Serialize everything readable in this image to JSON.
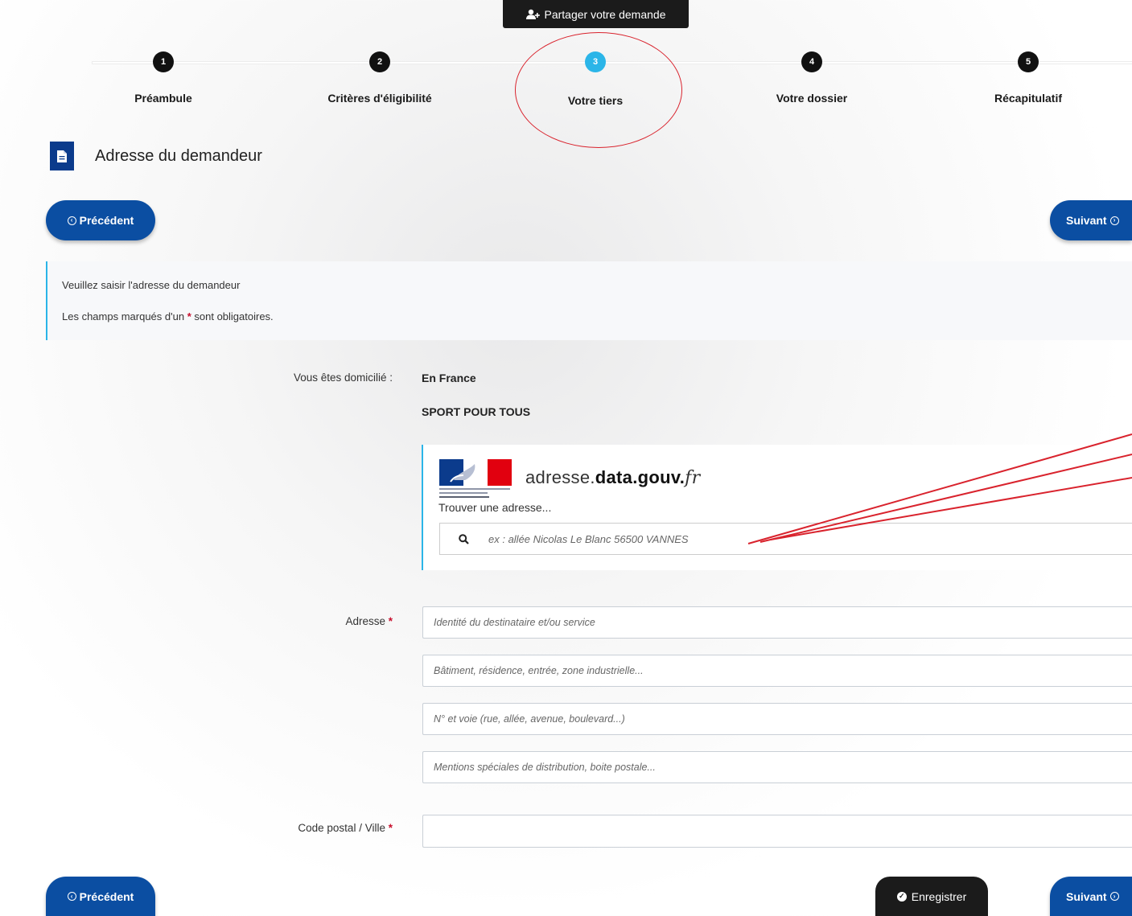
{
  "top": {
    "share_label": "Partager votre demande"
  },
  "stepper": {
    "steps": [
      {
        "num": "1",
        "label": "Préambule"
      },
      {
        "num": "2",
        "label": "Critères d'éligibilité"
      },
      {
        "num": "3",
        "label": "Votre tiers"
      },
      {
        "num": "4",
        "label": "Votre dossier"
      },
      {
        "num": "5",
        "label": "Récapitulatif"
      }
    ],
    "active_step": 3
  },
  "section": {
    "title": "Adresse du demandeur"
  },
  "nav": {
    "previous": "Précédent",
    "next": "Suivant",
    "save": "Enregistrer"
  },
  "info": {
    "line1": "Veuillez saisir l'adresse du demandeur",
    "line2_before": "Les champs marqués d'un",
    "required_mark": "*",
    "line2_after": "sont obligatoires."
  },
  "form": {
    "domicile_label": "Vous êtes domicilié :",
    "domicile_value": "En France",
    "organization": "SPORT POUR TOUS",
    "ban": {
      "brand_prefix": "adresse.",
      "brand_bold": "data.gouv.",
      "brand_suffix": "fr",
      "find_label": "Trouver une adresse...",
      "search_placeholder": "ex : allée Nicolas Le Blanc 56500 VANNES"
    },
    "address_label": "Adresse",
    "address_placeholders": [
      "Identité du destinataire et/ou service",
      "Bâtiment, résidence, entrée, zone industrielle...",
      "N° et voie (rue, allée, avenue, boulevard...)",
      "Mentions spéciales de distribution, boite postale..."
    ],
    "postal_label": "Code postal / Ville"
  },
  "colors": {
    "primary": "#0b4ea2",
    "accent": "#2bb5e8",
    "dark": "#1b1b1b",
    "required": "#c8102e",
    "annotation": "#d9232d"
  }
}
